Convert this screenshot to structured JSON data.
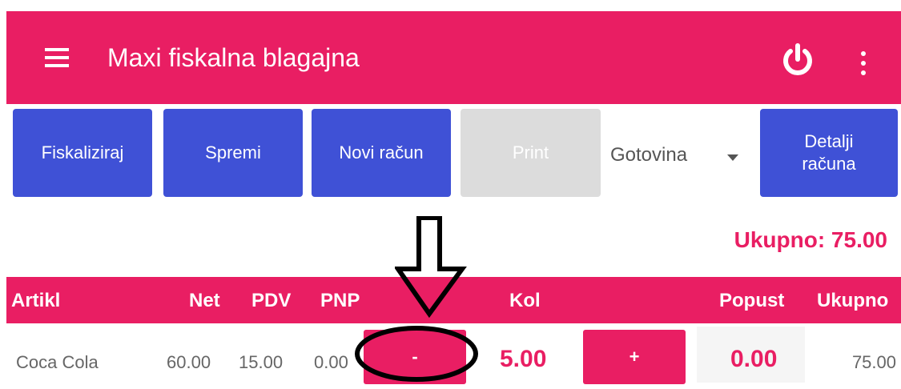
{
  "app": {
    "title": "Maxi fiskalna blagajna"
  },
  "toolbar": {
    "fiskaliziraj": "Fiskaliziraj",
    "spremi": "Spremi",
    "novi_racun": "Novi račun",
    "print": "Print",
    "payment_method": "Gotovina",
    "detalji_line1": "Detalji",
    "detalji_line2": "računa"
  },
  "total_label": "Ukupno: 75.00",
  "table": {
    "headers": {
      "artikl": "Artikl",
      "net": "Net",
      "pdv": "PDV",
      "pnp": "PNP",
      "kol": "Kol",
      "popust": "Popust",
      "ukupno": "Ukupno"
    },
    "rows": [
      {
        "artikl": "Coca Cola",
        "net": "60.00",
        "pdv": "15.00",
        "pnp": "0.00",
        "minus": "-",
        "kol": "5.00",
        "plus": "+",
        "popust": "0.00",
        "ukupno": "75.00"
      }
    ]
  },
  "colors": {
    "primary": "#e91e63",
    "button_blue": "#3f51d6",
    "disabled": "#dcdcdc"
  },
  "icons": [
    "menu-icon",
    "power-icon",
    "more-vert-icon",
    "dropdown-arrow-icon"
  ]
}
